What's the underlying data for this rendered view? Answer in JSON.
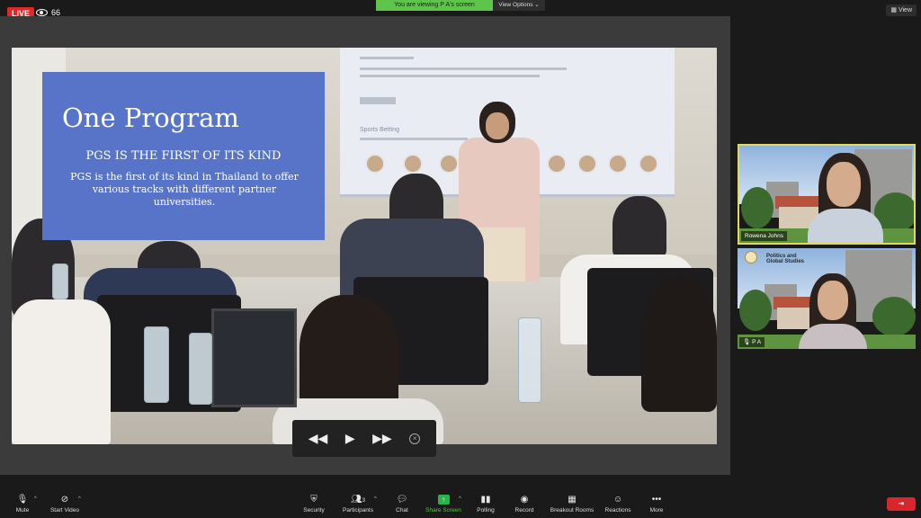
{
  "topbar": {
    "live": "LIVE",
    "viewers": "66",
    "viewing_banner": "You are viewing P A's screen",
    "view_options": "View Options ⌄",
    "view_button": "View"
  },
  "slide": {
    "title": "One Program",
    "subtitle": "PGS IS THE FIRST OF ITS KIND",
    "body": "PGS is the first of its kind in Thailand to offer various tracks with different partner universities.",
    "screen_heading": "Sports Betting"
  },
  "participants": [
    {
      "name": "Rowena Johns"
    },
    {
      "name": "P A",
      "logo_line1": "Politics and",
      "logo_line2": "Global Studies"
    }
  ],
  "toolbar": {
    "mute": "Mute",
    "start_video": "Start Video",
    "security": "Security",
    "participants": "Participants",
    "participants_count": "3",
    "chat": "Chat",
    "share_screen": "Share Screen",
    "polling": "Polling",
    "record": "Record",
    "breakout_rooms": "Breakout Rooms",
    "reactions": "Reactions",
    "more": "More",
    "leave": "Leave"
  },
  "colors": {
    "slide_blue": "#5774c8",
    "share_green": "#5ec44a",
    "live_red": "#e02828",
    "active_speaker": "#e0dc5a"
  }
}
